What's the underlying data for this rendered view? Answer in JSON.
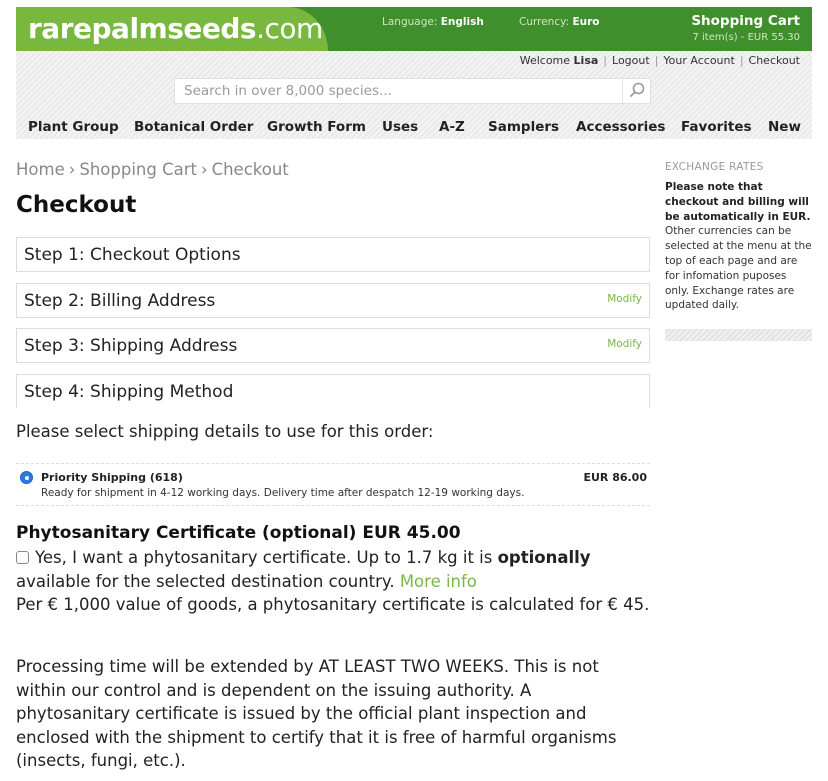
{
  "header": {
    "logo_main": "rarepalmseeds",
    "logo_tld": ".com",
    "language_label": "Language:",
    "language_value": "English",
    "currency_label": "Currency:",
    "currency_value": "Euro",
    "cart_title": "Shopping Cart",
    "cart_summary": "7 item(s) - EUR 55.30",
    "colors": {
      "dark_green": "#3f8f2d",
      "light_green": "#78b83e",
      "link_green": "#7ab843"
    }
  },
  "user_links": {
    "welcome_prefix": "Welcome",
    "username": "Lisa",
    "logout": "Logout",
    "account": "Your Account",
    "checkout": "Checkout"
  },
  "search": {
    "placeholder": "Search in over 8,000 species...",
    "icon": "search-icon"
  },
  "nav": {
    "items": [
      "Plant Group",
      "Botanical Order",
      "Growth Form",
      "Uses",
      "A-Z",
      "Samplers",
      "Accessories",
      "Favorites",
      "New"
    ]
  },
  "breadcrumb": [
    "Home",
    "Shopping Cart",
    "Checkout"
  ],
  "breadcrumb_sep": "›",
  "page_title": "Checkout",
  "steps": [
    {
      "label": "Step 1: Checkout Options",
      "modify": ""
    },
    {
      "label": "Step 2: Billing Address",
      "modify": "Modify"
    },
    {
      "label": "Step 3: Shipping Address",
      "modify": "Modify"
    },
    {
      "label": "Step 4: Shipping Method",
      "modify": ""
    }
  ],
  "shipping": {
    "prompt": "Please select shipping details to use for this order:",
    "option_name": "Priority Shipping (618)",
    "option_desc": "Ready for shipment in 4-12 working days. Delivery time after despatch 12-19 working days.",
    "option_price": "EUR 86.00",
    "selected": true
  },
  "phyto": {
    "title": "Phytosanitary Certificate (optional) EUR 45.00",
    "check_text_1": "Yes, I want a phytosanitary certificate. Up to 1.7 kg it is ",
    "check_text_bold": "optionally",
    "check_text_2": " available for the selected destination country. ",
    "more_info": "More info",
    "per_value": "Per € 1,000 value of goods, a phytosanitary certificate is calculated for € 45.",
    "checked": false
  },
  "processing_text": "Processing time will be extended by AT LEAST TWO WEEKS. This is not within our control and is dependent on the issuing authority. A phytosanitary certificate is issued by the official plant inspection and enclosed with the shipment to certify that it is free of harmful organisms (insects, fungi, etc.).",
  "sidebar": {
    "title": "EXCHANGE RATES",
    "bold_text": "Please note that checkout and billing will be automatically in EUR.",
    "text": "Other currencies can be selected at the menu at the top of each page and are for infomation puposes only. Exchange rates are updated daily."
  }
}
